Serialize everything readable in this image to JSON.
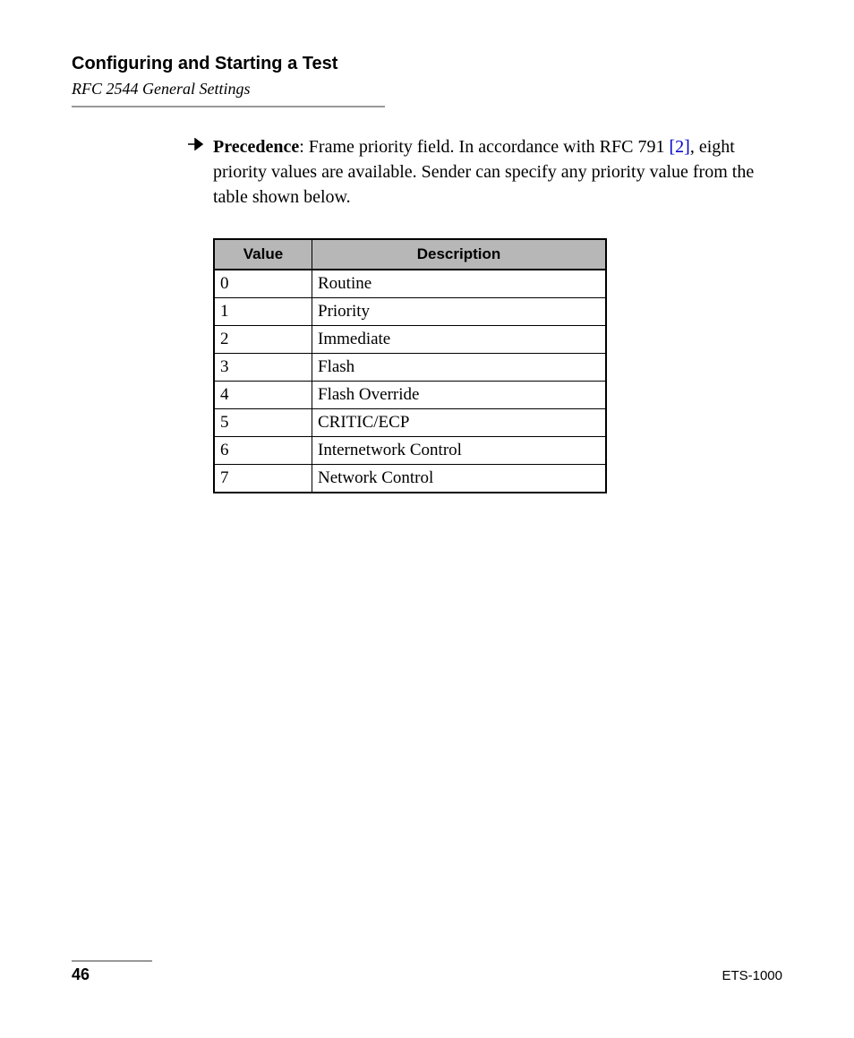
{
  "header": {
    "section_title": "Configuring and Starting a Test",
    "subsection": "RFC 2544 General Settings"
  },
  "paragraph": {
    "term": "Precedence",
    "text_before_ref": ": Frame priority field. In accordance with RFC 791 ",
    "ref": "[2]",
    "text_after_ref": ", eight priority values are available. Sender can specify any priority value from the table shown below."
  },
  "table": {
    "headers": {
      "value": "Value",
      "description": "Description"
    },
    "rows": [
      {
        "value": "0",
        "description": "Routine"
      },
      {
        "value": "1",
        "description": "Priority"
      },
      {
        "value": "2",
        "description": "Immediate"
      },
      {
        "value": "3",
        "description": "Flash"
      },
      {
        "value": "4",
        "description": "Flash Override"
      },
      {
        "value": "5",
        "description": "CRITIC/ECP"
      },
      {
        "value": "6",
        "description": "Internetwork Control"
      },
      {
        "value": "7",
        "description": "Network Control"
      }
    ]
  },
  "footer": {
    "page_number": "46",
    "model": "ETS-1000"
  }
}
